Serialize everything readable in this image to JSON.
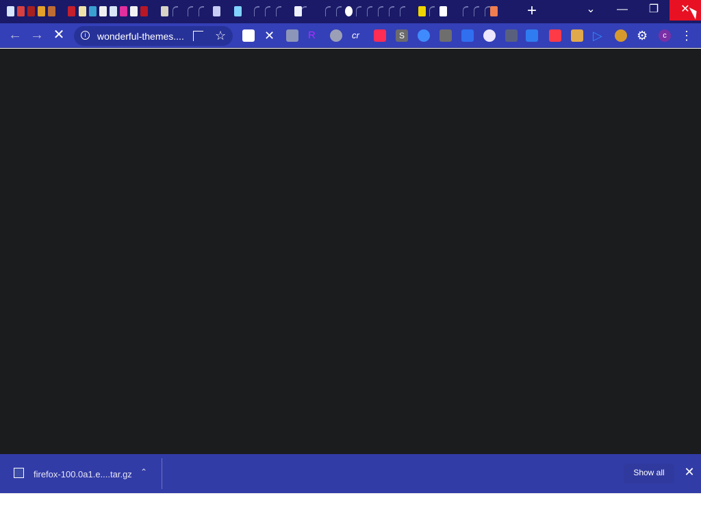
{
  "browser": {
    "url": "wonderful-themes....",
    "tabs_icons": [
      "steam-icon",
      "mail-icon",
      "app-icon",
      "app-icon",
      "app-icon",
      "doc-icon",
      "brand-icon",
      "bag-icon",
      "app-icon",
      "app-icon",
      "app-icon",
      "app-icon",
      "app-icon",
      "app-icon",
      "app-icon"
    ]
  },
  "shelf": {
    "file_name": "firefox-100.0a1.e....tar.gz",
    "show_all_label": "Show all"
  },
  "colors": {
    "tabstrip": "#1a1a68",
    "toolbar": "#3440b8",
    "content": "#1b1c1e",
    "shelf": "#323ca7",
    "close_red": "#e81123"
  }
}
